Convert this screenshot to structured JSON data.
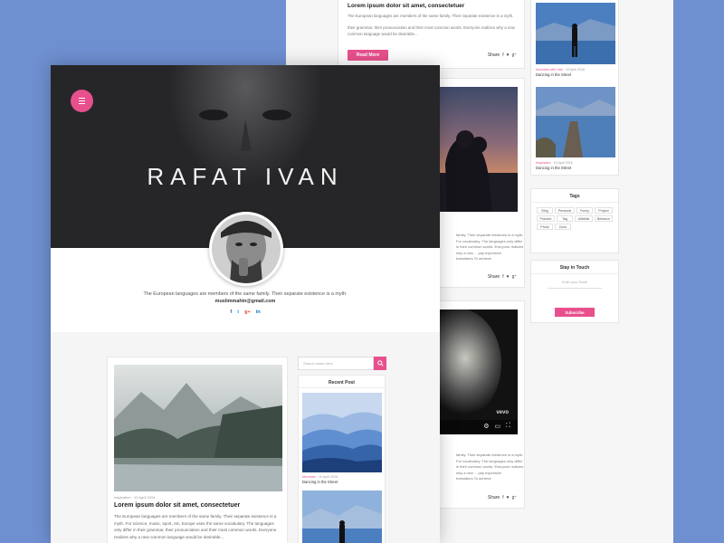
{
  "back": {
    "post1": {
      "title": "Lorem ipsum dolor sit amet, consectetuer",
      "text1": "The European languages are members of the same family. Their separate existence is a myth.",
      "text2": "their grammar, their pronunciation and their most common words. Everyone realizes why a new common language would be desirable...",
      "read_more": "Read More",
      "share": "Share"
    },
    "post2": {
      "text": "family. Their separate existence is a myth. For vocabulary. The languages only differ in their common words. Everyone realizes why a new ... pay expensive translators.To achieve",
      "share": "Share"
    },
    "post3": {
      "text": "family. Their separate existence is a myth. For vocabulary. The languages only differ in their common words. Everyone realizes why a new ... pay expensive translators.To achieve",
      "share": "Share",
      "video_brand": "vevo"
    },
    "sidebar": {
      "item1": {
        "category": "Mountain with Hair",
        "date": "10 April 2016",
        "title": "Dancing in the Street"
      },
      "item2": {
        "category": "Inspiration",
        "date": "10 April 2016",
        "title": "Dancing in the Street"
      },
      "tags_title": "Tags",
      "tags": [
        "Blog",
        "Personal",
        "Funny",
        "Project",
        "Practice",
        "Tag",
        "dribbble",
        "Behance",
        "Photo",
        "Color"
      ],
      "stay_title": "Stay in Touch",
      "email_placeholder": "Enter your Email",
      "subscribe": "Subscribe"
    }
  },
  "front": {
    "name": "RAFAT IVAN",
    "bio": "The European languages are members of the same family. Their separate existence is a myth.",
    "email": "muslimmahin@gmail.com",
    "social": [
      "f",
      "t",
      "g+",
      "in"
    ],
    "post": {
      "category": "Inspiration",
      "date": "10 April 2016",
      "title": "Lorem ipsum dolor sit amet, consectetuer",
      "text": "The European languages are members of the same family. Their separate existence is a myth. For science, music, sport, etc, Europe uses the same vocabulary. The languages only differ in their grammar, their pronunciation and their most common words. Everyone realizes why a new common language would be desirable..."
    },
    "search_placeholder": "Search make here",
    "recent": {
      "title": "Recent Post",
      "item1": {
        "category": "Mountain",
        "date": "10 April 2016",
        "title": "Dancing in the Street"
      }
    }
  },
  "colors": {
    "accent": "#e8508d",
    "background": "#6e8fd0"
  }
}
